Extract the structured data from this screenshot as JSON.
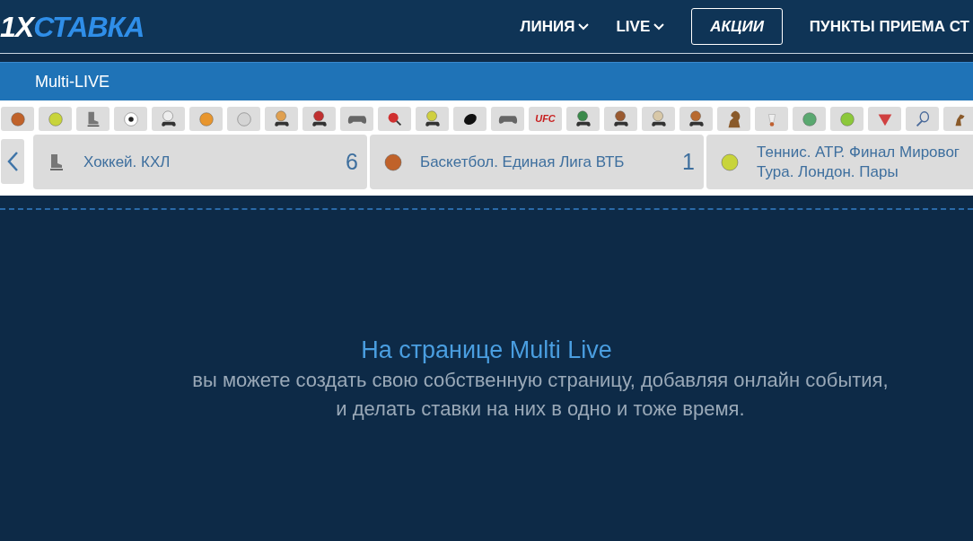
{
  "header": {
    "logo": {
      "prefix": "1X",
      "name": "СТАВКА"
    },
    "nav": [
      {
        "label": "ЛИНИЯ",
        "kind": "dropdown"
      },
      {
        "label": "LIVE",
        "kind": "dropdown"
      },
      {
        "label": "АКЦИИ",
        "kind": "outlined"
      },
      {
        "label": "ПУНКТЫ ПРИЕМА СТ",
        "kind": "plain"
      }
    ]
  },
  "section_title": "Multi-LIVE",
  "sport_icons": [
    {
      "kind": "ball",
      "color": "#c0622a"
    },
    {
      "kind": "ball",
      "color": "#c8d43a"
    },
    {
      "kind": "skate"
    },
    {
      "kind": "soccer"
    },
    {
      "kind": "ball-controller",
      "color": "#eeeeee"
    },
    {
      "kind": "ball",
      "color": "#e8962e"
    },
    {
      "kind": "ball",
      "color": "#d4d4d4"
    },
    {
      "kind": "ball-controller",
      "color": "#e0a050"
    },
    {
      "kind": "ball-controller",
      "color": "#c03030"
    },
    {
      "kind": "controller"
    },
    {
      "kind": "paddle"
    },
    {
      "kind": "ball-controller",
      "color": "#d0d040"
    },
    {
      "kind": "puck"
    },
    {
      "kind": "controller"
    },
    {
      "kind": "ufc",
      "label": "UFC"
    },
    {
      "kind": "ball-controller",
      "color": "#3a8a4a"
    },
    {
      "kind": "ball-controller",
      "color": "#9a5a30"
    },
    {
      "kind": "ball-controller",
      "color": "#d8c8a8"
    },
    {
      "kind": "ball-controller",
      "color": "#b86a30"
    },
    {
      "kind": "chess"
    },
    {
      "kind": "shuttlecock"
    },
    {
      "kind": "ball",
      "color": "#5aa870"
    },
    {
      "kind": "ball",
      "color": "#8cc83a"
    },
    {
      "kind": "snooker"
    },
    {
      "kind": "racket"
    },
    {
      "kind": "horse"
    }
  ],
  "events": [
    {
      "kind": "skate",
      "title": "Хоккей. КХЛ",
      "count": "6"
    },
    {
      "kind": "basketball",
      "title": "Баскетбол. Единая Лига ВТБ",
      "count": "1"
    },
    {
      "kind": "tennis",
      "title": "Теннис. АТР. Финал Мировог\nТура. Лондон. Пары"
    }
  ],
  "empty_state": {
    "title": "На странице Multi Live",
    "text": "вы можете создать свою собственную страницу, добавляя онлайн события,\nи делать ставки на них в одно и тоже время."
  }
}
